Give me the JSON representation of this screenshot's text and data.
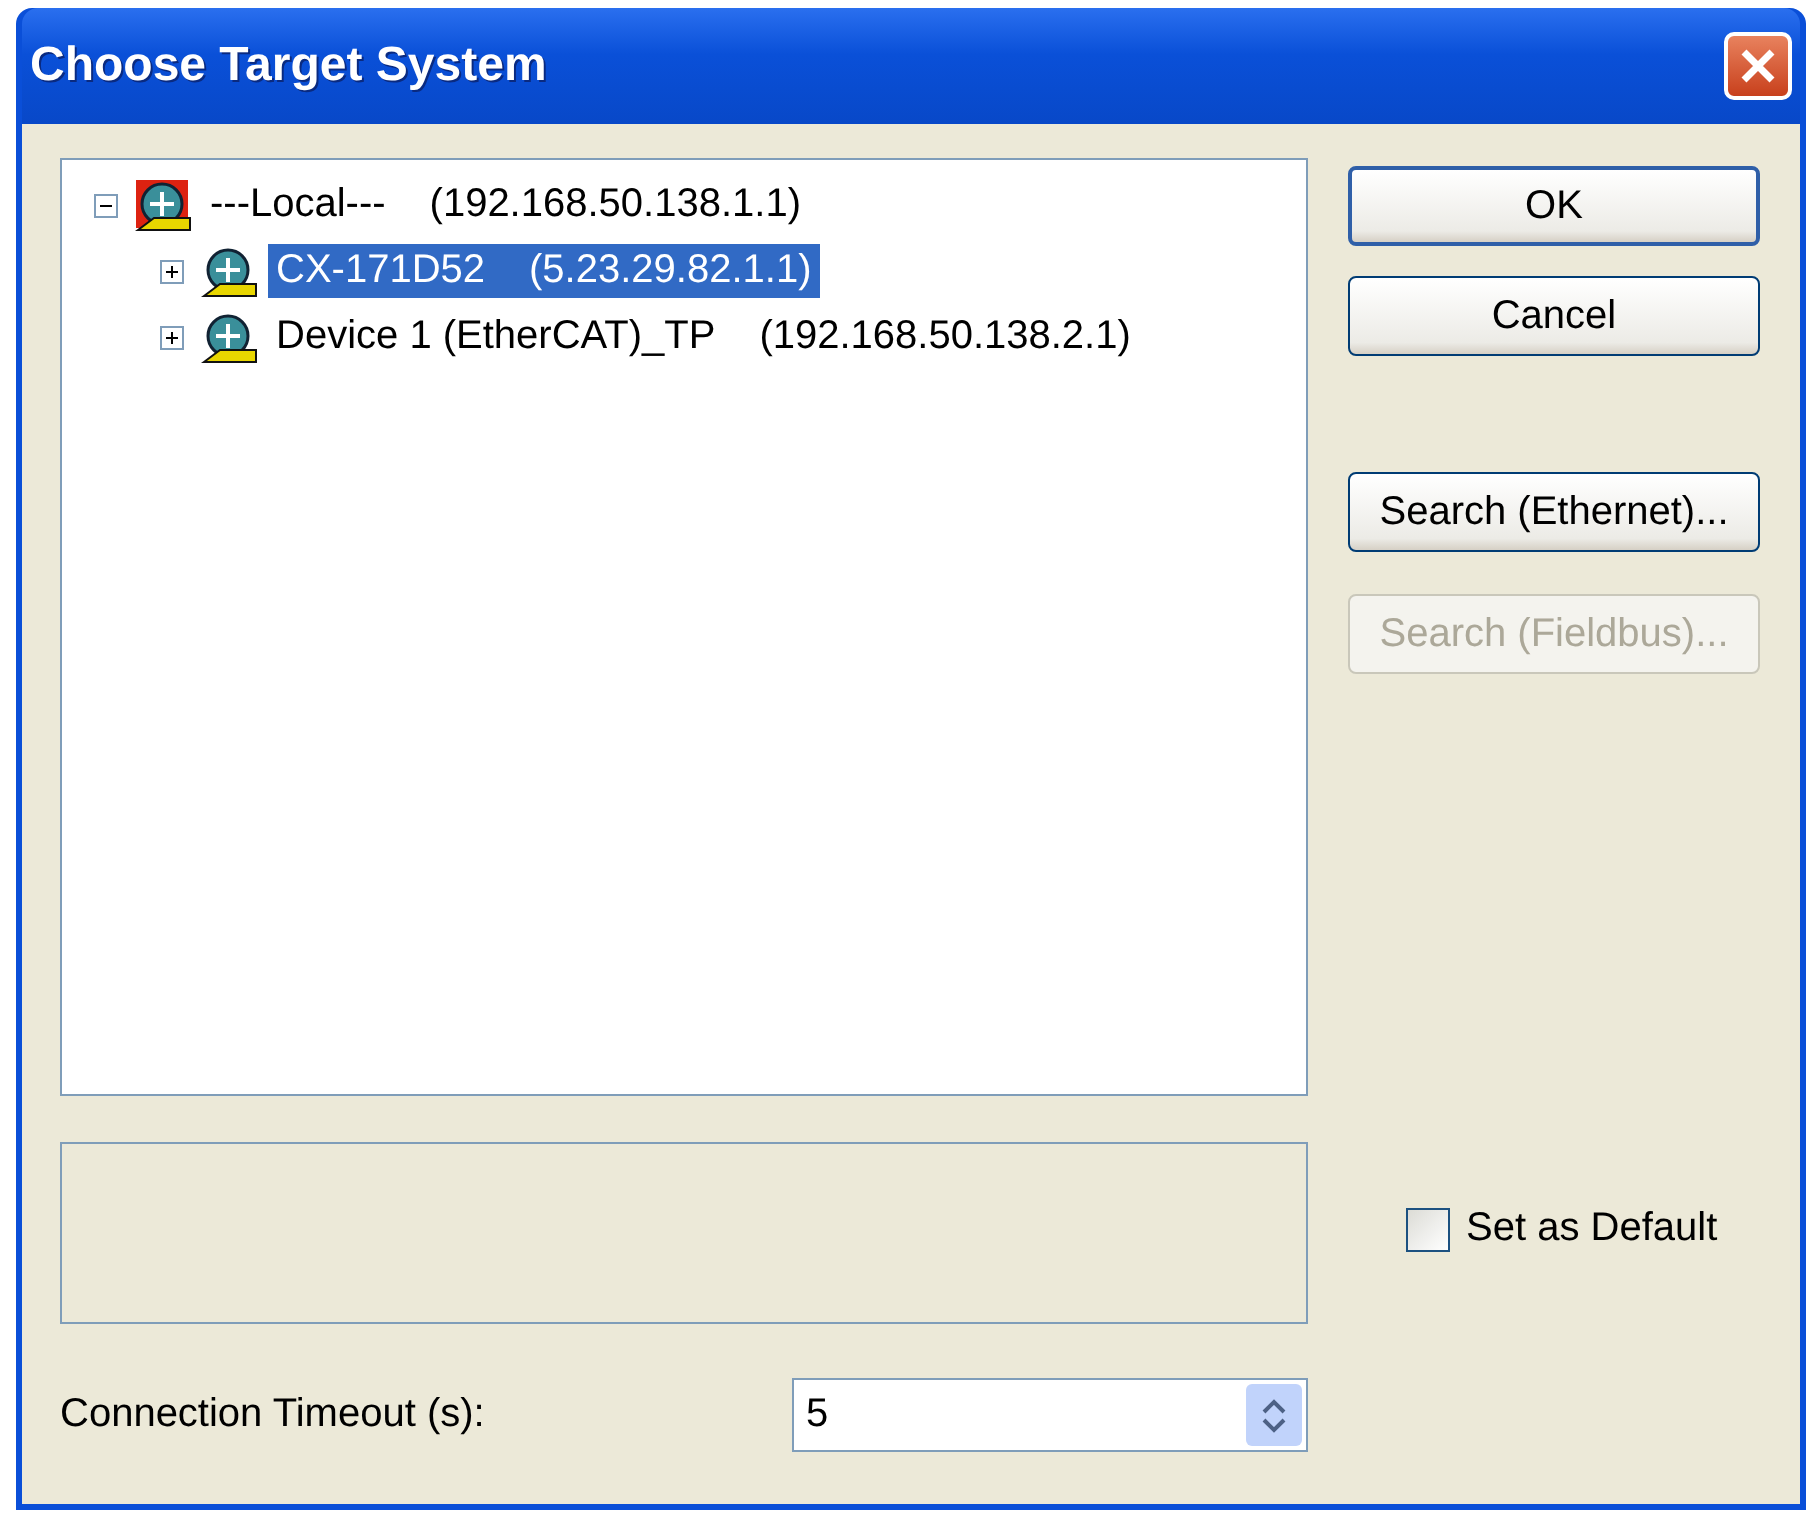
{
  "window": {
    "title": "Choose Target System"
  },
  "tree": [
    {
      "name": "---Local---",
      "address": "(192.168.50.138.1.1)",
      "expanded": true,
      "selected": false,
      "children": [
        {
          "name": "CX-171D52",
          "address": "(5.23.29.82.1.1)",
          "expanded": false,
          "selected": true
        },
        {
          "name": "Device 1 (EtherCAT)_TP",
          "address": "(192.168.50.138.2.1)",
          "expanded": false,
          "selected": false
        }
      ]
    }
  ],
  "buttons": [
    {
      "label": "OK",
      "disabled": false,
      "default": true
    },
    {
      "label": "Cancel",
      "disabled": false,
      "default": false
    },
    {
      "label": "Search (Ethernet)...",
      "disabled": false,
      "default": false
    },
    {
      "label": "Search (Fieldbus)...",
      "disabled": true,
      "default": false
    }
  ],
  "set_as_default": {
    "label": "Set as Default",
    "checked": false
  },
  "timeout": {
    "label": "Connection Timeout (s):",
    "value": "5"
  }
}
